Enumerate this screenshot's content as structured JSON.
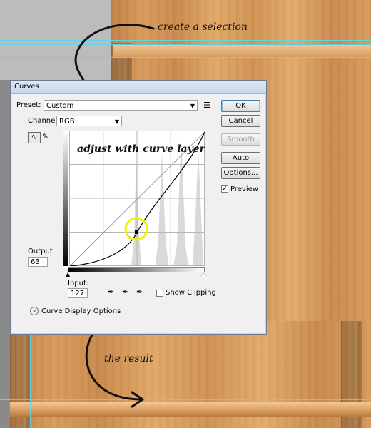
{
  "annotations": {
    "create_selection": "create a selection",
    "adjust_curve": "adjust with curve layer",
    "result": "the result"
  },
  "dialog": {
    "title": "Curves",
    "preset_label": "Preset:",
    "preset_value": "Custom",
    "channel_label": "Channel:",
    "channel_value": "RGB",
    "output_label": "Output:",
    "output_value": "63",
    "input_label": "Input:",
    "input_value": "127",
    "show_clipping_label": "Show Clipping",
    "show_clipping_checked": false,
    "curve_display_options": "Curve Display Options",
    "buttons": {
      "ok": "OK",
      "cancel": "Cancel",
      "smooth": "Smooth",
      "auto": "Auto",
      "options": "Options..."
    },
    "preview_label": "Preview",
    "preview_checked": true
  },
  "colors": {
    "guide": "#56d8f0",
    "highlight_circle": "#f3f000",
    "wood_light": "#e0a868",
    "wood_dark": "#b8763c"
  }
}
